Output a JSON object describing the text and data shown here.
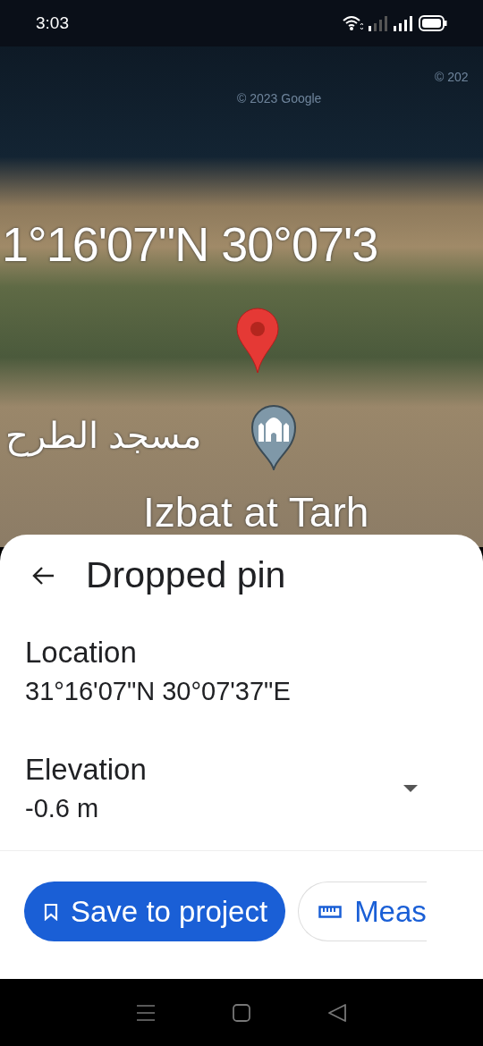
{
  "status_bar": {
    "time": "3:03"
  },
  "map": {
    "attributions": [
      "© 2023 Google",
      "© 202"
    ],
    "coordinates_label": "1°16'07\"N 30°07'3",
    "place_label": "مسجد الطرح",
    "area_label": "Izbat at Tarh"
  },
  "sheet": {
    "title": "Dropped pin",
    "fields": [
      {
        "label": "Location",
        "value": "31°16'07\"N 30°07'37\"E",
        "expandable": false
      },
      {
        "label": "Elevation",
        "value": "-0.6 m",
        "expandable": true
      }
    ],
    "actions": [
      {
        "label": "Save to project",
        "kind": "primary"
      },
      {
        "label": "Meas",
        "kind": "outline"
      }
    ]
  }
}
